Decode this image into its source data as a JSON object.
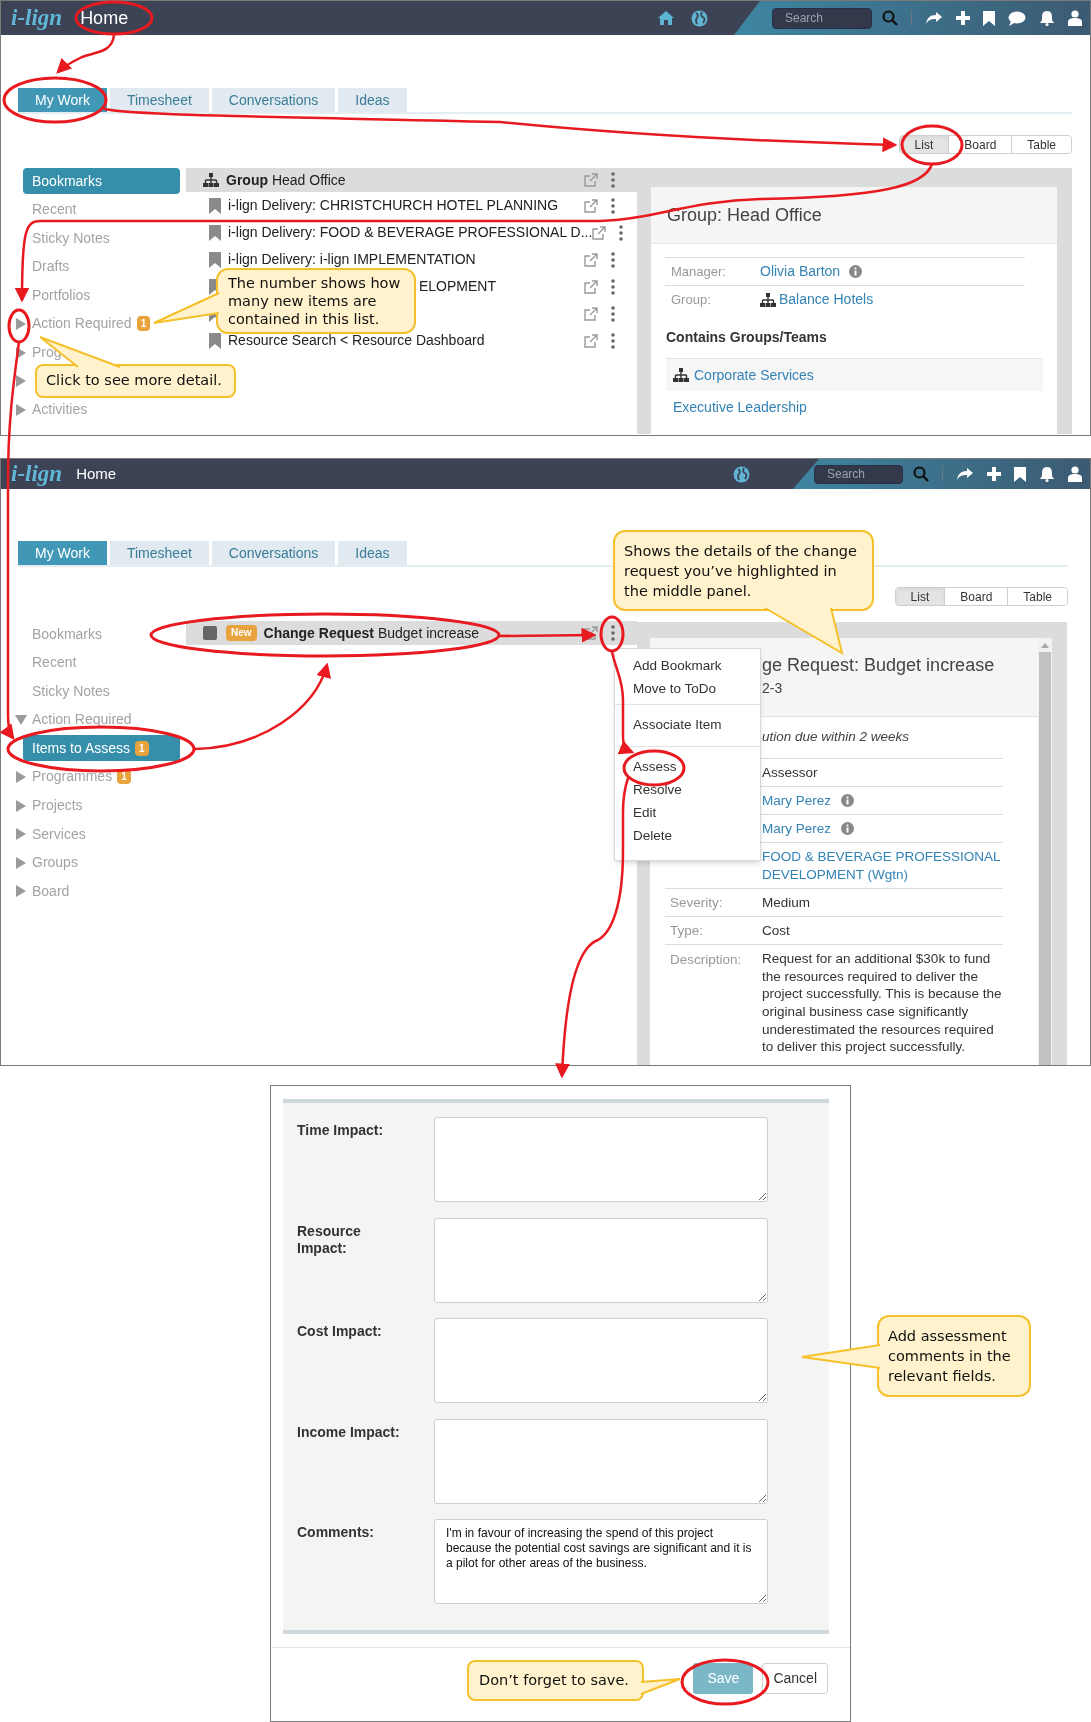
{
  "screen_1": {
    "header": {
      "logo": "i-lign",
      "title": "Home",
      "search_placeholder": "Search",
      "icons_left": [
        {
          "kind": "home"
        },
        {
          "kind": "globe"
        }
      ],
      "icons_right": [
        {
          "kind": "search"
        },
        {
          "kind": "share"
        },
        {
          "kind": "plus"
        },
        {
          "kind": "bookmark"
        },
        {
          "kind": "chat"
        },
        {
          "kind": "bell"
        },
        {
          "kind": "user"
        }
      ]
    },
    "tabs": [
      {
        "label": "My Work",
        "selected": true
      },
      {
        "label": "Timesheet",
        "selected": false
      },
      {
        "label": "Conversations",
        "selected": false
      },
      {
        "label": "Ideas",
        "selected": false
      }
    ],
    "views": [
      {
        "label": "List",
        "selected": true
      },
      {
        "label": "Board",
        "selected": false
      },
      {
        "label": "Table",
        "selected": false
      }
    ],
    "sidebar": [
      {
        "kind": "link",
        "label": "Bookmarks",
        "selected": true
      },
      {
        "kind": "link",
        "label": "Recent",
        "selected": false
      },
      {
        "kind": "link",
        "label": "Sticky Notes",
        "selected": false
      },
      {
        "kind": "link",
        "label": "Drafts",
        "selected": false
      },
      {
        "kind": "link",
        "label": "Portfolios",
        "selected": false
      },
      {
        "kind": "group",
        "label": "Action Required",
        "badge": "1",
        "expanded": false,
        "selected": false
      },
      {
        "kind": "group",
        "label": "Prog",
        "expanded": false,
        "selected": false
      },
      {
        "kind": "group",
        "expanded": false,
        "selected": false
      },
      {
        "kind": "group",
        "label": "Activities",
        "expanded": false,
        "selected": false
      }
    ],
    "list": [
      {
        "kind": "group",
        "text": "**Group** Head Office",
        "selected": true,
        "covered": false
      },
      {
        "kind": "bookmark",
        "text": "i-lign Delivery: CHRISTCHURCH HOTEL PLANNING",
        "selected": false,
        "covered": false
      },
      {
        "kind": "bookmark",
        "text": "i-lign Delivery: FOOD & BEVERAGE PROFESSIONAL D...",
        "selected": false,
        "covered": false
      },
      {
        "kind": "bookmark",
        "text": "i-lign Delivery: i-lign IMPLEMENTATION",
        "selected": false,
        "covered": false
      },
      {
        "kind": "bookmark",
        "text": "ELOPMENT",
        "selected": false,
        "covered": true
      },
      {
        "kind": "bookmark",
        "selected": false
      },
      {
        "kind": "bookmark",
        "text": "Resource Search < Resource Dashboard",
        "selected": false,
        "covered": false
      }
    ],
    "detail": {
      "title": "Group: Head Office",
      "fields": [
        {
          "label": "Manager:",
          "value": "Olivia Barton",
          "kind": "person"
        },
        {
          "label": "Group:",
          "value": "Balance Hotels",
          "kind": "group"
        }
      ],
      "section": "Contains Groups/Teams",
      "members": [
        {
          "label": "Corporate Services",
          "kind": "group",
          "selected": true
        },
        {
          "label": "Executive Leadership",
          "kind": "team",
          "selected": false
        }
      ]
    },
    "callouts": [
      "The number shows how many new items are contained in this list.",
      "Click to see more detail."
    ]
  },
  "screen_2": {
    "header": {
      "logo": "i-lign",
      "title": "Home",
      "search_placeholder": "Search",
      "icons_left": [
        {
          "kind": "globe"
        }
      ],
      "icons_right": [
        {
          "kind": "search"
        },
        {
          "kind": "share"
        },
        {
          "kind": "plus"
        },
        {
          "kind": "bookmark"
        },
        {
          "kind": "bell"
        },
        {
          "kind": "user"
        }
      ]
    },
    "tabs": [
      {
        "label": "My Work",
        "selected": true
      },
      {
        "label": "Timesheet",
        "selected": false
      },
      {
        "label": "Conversations",
        "selected": false
      },
      {
        "label": "Ideas",
        "selected": false
      }
    ],
    "views": [
      {
        "label": "List",
        "selected": true
      },
      {
        "label": "Board",
        "selected": false
      },
      {
        "label": "Table",
        "selected": false
      }
    ],
    "sidebar": [
      {
        "kind": "link",
        "label": "Bookmarks",
        "selected": false
      },
      {
        "kind": "link",
        "label": "Recent",
        "selected": false
      },
      {
        "kind": "link",
        "label": "Sticky Notes",
        "selected": false
      },
      {
        "kind": "group",
        "label": "Action Required",
        "expanded": true,
        "selected": false,
        "children": [
          {
            "kind": "link",
            "label": "Items to Assess",
            "badge": "1",
            "selected": true
          }
        ]
      },
      {
        "kind": "group",
        "label": "Programmes",
        "badge": "1",
        "expanded": false,
        "selected": false
      },
      {
        "kind": "group",
        "label": "Projects",
        "expanded": false,
        "selected": false
      },
      {
        "kind": "group",
        "label": "Services",
        "expanded": false,
        "selected": false
      },
      {
        "kind": "group",
        "label": "Groups",
        "expanded": false,
        "selected": false
      },
      {
        "kind": "group",
        "label": "Board",
        "expanded": false,
        "selected": false
      }
    ],
    "list": [
      {
        "kind": "item",
        "badge": "New",
        "text": "**Change Request** Budget increase",
        "selected": true,
        "covered": false
      }
    ],
    "menu": [
      {
        "items": [
          "Add Bookmark",
          "Move to ToDo"
        ]
      },
      {
        "items": [
          "Associate Item"
        ]
      },
      {
        "items": [
          "Assess",
          "Resolve",
          "Edit",
          "Delete"
        ]
      }
    ],
    "detail": {
      "title": "ge Request: Budget increase",
      "subtitle": "2-3",
      "note": "ution due within 2 weeks",
      "fields": [
        {
          "value": "Assessor",
          "kind": "text"
        },
        {
          "value": "Mary Perez",
          "kind": "person"
        },
        {
          "value": "Mary Perez",
          "kind": "person"
        },
        {
          "value": "FOOD & BEVERAGE PROFESSIONAL DEVELOPMENT (Wgtn)",
          "kind": "link"
        },
        {
          "label": "Severity:",
          "value": "Medium",
          "kind": "text"
        },
        {
          "label": "Type:",
          "value": "Cost",
          "kind": "text"
        },
        {
          "label": "Description:",
          "value": "Request for an additional $30k to fund the resources required to deliver the project successfully. This is because the original business case significantly underestimated the resources required to deliver this project successfully.",
          "kind": "text"
        }
      ]
    },
    "callout": "Shows the details of the change request you’ve highlighted in the middle panel."
  },
  "assess_form": {
    "fields": [
      {
        "label": "Time Impact:"
      },
      {
        "label": "Resource Impact:"
      },
      {
        "label": "Cost Impact:"
      },
      {
        "label": "Income Impact:"
      },
      {
        "label": "Comments:",
        "value": "I'm in favour of increasing the spend of this project because the potential cost savings are significant and it is a pilot for other areas of the business."
      }
    ],
    "buttons": [
      {
        "label": "Save",
        "kind": "primary"
      },
      {
        "label": "Cancel",
        "kind": "secondary"
      }
    ],
    "callouts": [
      "Add assessment comments in the relevant fields.",
      "Don’t forget to save."
    ]
  }
}
